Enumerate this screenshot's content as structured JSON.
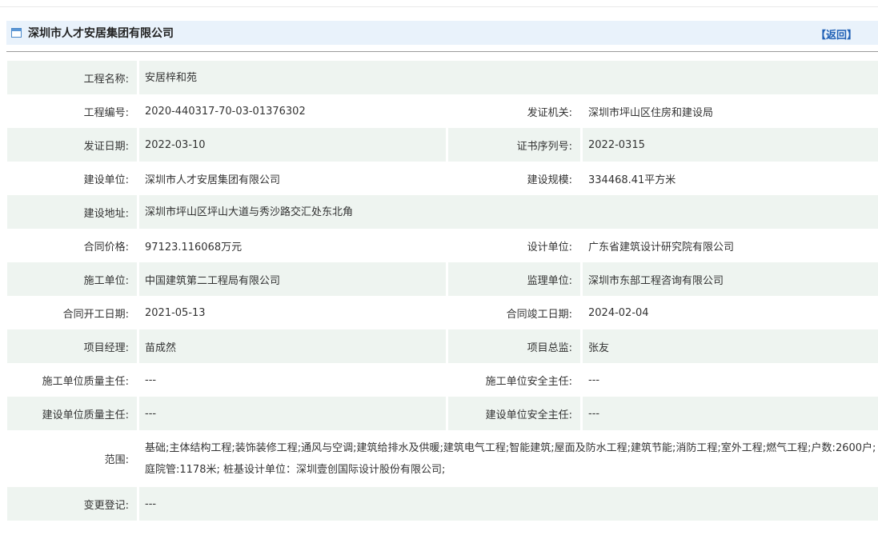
{
  "header": {
    "title": "深圳市人才安居集团有限公司",
    "back_label": "【返回】",
    "icon": "window-icon"
  },
  "fields": {
    "project_name": {
      "label": "工程名称:",
      "value": "安居梓和苑"
    },
    "project_code": {
      "label": "工程编号:",
      "value": "2020-440317-70-03-01376302"
    },
    "issuer": {
      "label": "发证机关:",
      "value": "深圳市坪山区住房和建设局"
    },
    "issue_date": {
      "label": "发证日期:",
      "value": "2022-03-10"
    },
    "cert_serial": {
      "label": "证书序列号:",
      "value": "2022-0315"
    },
    "builder": {
      "label": "建设单位:",
      "value": "深圳市人才安居集团有限公司"
    },
    "scale": {
      "label": "建设规模:",
      "value": "334468.41平方米"
    },
    "address": {
      "label": "建设地址:",
      "value": "深圳市坪山区坪山大道与秀沙路交汇处东北角"
    },
    "contract_price": {
      "label": "合同价格:",
      "value": "97123.116068万元"
    },
    "design_unit": {
      "label": "设计单位:",
      "value": "广东省建筑设计研究院有限公司"
    },
    "construction_unit": {
      "label": "施工单位:",
      "value": "中国建筑第二工程局有限公司"
    },
    "supervision_unit": {
      "label": "监理单位:",
      "value": "深圳市东部工程咨询有限公司"
    },
    "start_date": {
      "label": "合同开工日期:",
      "value": "2021-05-13"
    },
    "end_date": {
      "label": "合同竣工日期:",
      "value": "2024-02-04"
    },
    "project_manager": {
      "label": "项目经理:",
      "value": "苗成然"
    },
    "chief_supervisor": {
      "label": "项目总监:",
      "value": "张友"
    },
    "construction_quality_head": {
      "label": "施工单位质量主任:",
      "value": "---"
    },
    "construction_safety_head": {
      "label": "施工单位安全主任:",
      "value": "---"
    },
    "builder_quality_head": {
      "label": "建设单位质量主任:",
      "value": "---"
    },
    "builder_safety_head": {
      "label": "建设单位安全主任:",
      "value": "---"
    },
    "scope": {
      "label": "范围:",
      "value": "基础;主体结构工程;装饰装修工程;通风与空调;建筑给排水及供暖;建筑电气工程;智能建筑;屋面及防水工程;建筑节能;消防工程;室外工程;燃气工程;户数:2600户;庭院管:1178米; 桩基设计单位：深圳壹创国际设计股份有限公司;"
    },
    "change_record": {
      "label": "变更登记:",
      "value": "---"
    }
  }
}
